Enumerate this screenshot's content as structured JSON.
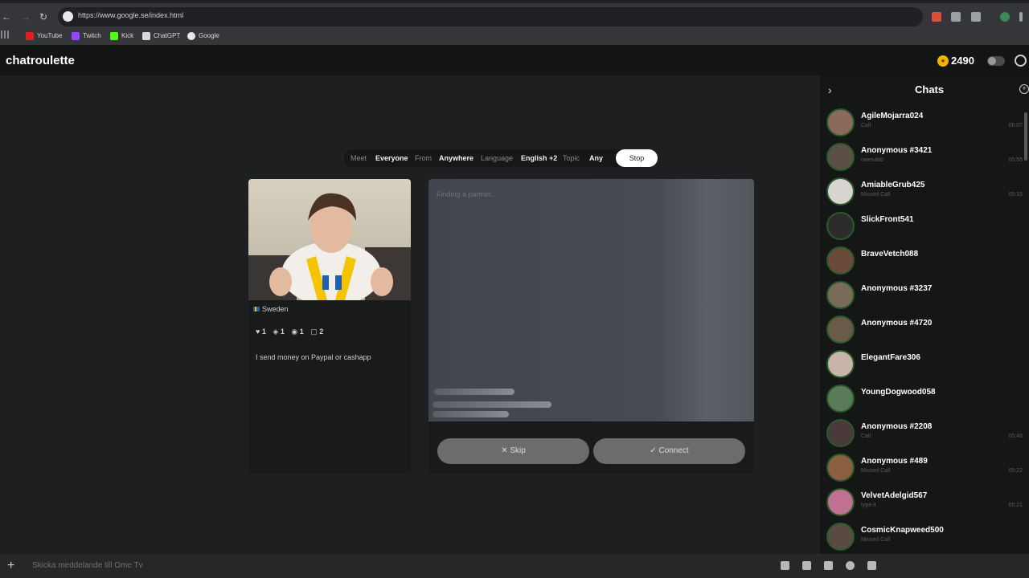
{
  "browser": {
    "url": "https://www.google.se/index.html",
    "bookmarks": [
      "YouTube",
      "Twitch",
      "Kick",
      "ChatGPT",
      "Google"
    ]
  },
  "header": {
    "brand": "chatroulette",
    "coins": "2490",
    "coin_icon": "coin-icon"
  },
  "filters": {
    "meet_label": "Meet",
    "meet_value": "Everyone",
    "from_label": "From",
    "from_value": "Anywhere",
    "language_label": "Language",
    "language_value": "English +2",
    "topic_label": "Topic",
    "topic_value": "Any",
    "stop_label": "Stop"
  },
  "self": {
    "country": "Sweden",
    "stats": [
      "1",
      "1",
      "1",
      "2"
    ],
    "bio": "I send money on Paypal or cashapp"
  },
  "partner": {
    "status": "Finding a partner...",
    "skip_label": "Skip",
    "connect_label": "Connect"
  },
  "chats": {
    "title": "Chats",
    "items": [
      {
        "name": "AgileMojarra024",
        "sub": "Call",
        "time": "06:07"
      },
      {
        "name": "Anonymous #3421",
        "sub": "owesabb",
        "time": "05:55"
      },
      {
        "name": "AmiableGrub425",
        "sub": "Missed Call",
        "time": "05:15"
      },
      {
        "name": "SlickFront541",
        "sub": "",
        "time": ""
      },
      {
        "name": "BraveVetch088",
        "sub": "",
        "time": ""
      },
      {
        "name": "Anonymous #3237",
        "sub": "",
        "time": ""
      },
      {
        "name": "Anonymous #4720",
        "sub": "",
        "time": ""
      },
      {
        "name": "ElegantFare306",
        "sub": "",
        "time": ""
      },
      {
        "name": "YoungDogwood058",
        "sub": "",
        "time": ""
      },
      {
        "name": "Anonymous #2208",
        "sub": "Call",
        "time": "05:48"
      },
      {
        "name": "Anonymous #489",
        "sub": "Missed Call",
        "time": "05:22"
      },
      {
        "name": "VelvetAdelgid567",
        "sub": "type it",
        "time": "05:21"
      },
      {
        "name": "CosmicKnapweed500",
        "sub": "Missed Call",
        "time": ""
      }
    ]
  },
  "bottom": {
    "input_placeholder": "Skicka meddelande till Ome Tv"
  },
  "colors": {
    "coin": "#f0b400",
    "stop_button": "#ffffff",
    "action_button": "#6b6c6e"
  }
}
